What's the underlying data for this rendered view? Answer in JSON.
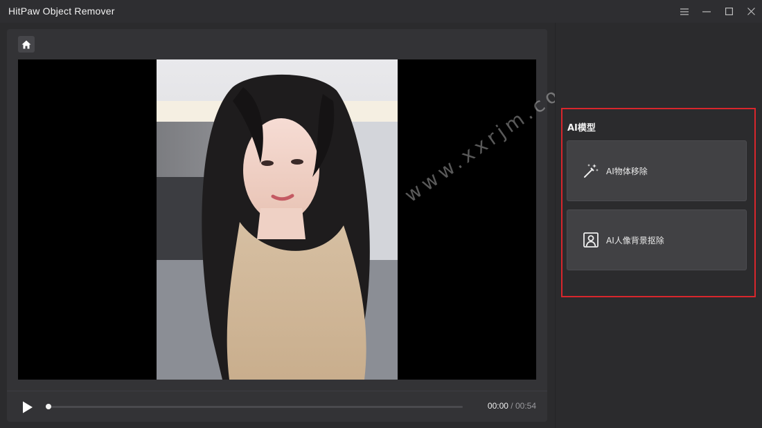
{
  "window": {
    "title": "HitPaw Object Remover",
    "controls": [
      "menu-icon",
      "minimize-icon",
      "maximize-icon",
      "close-icon"
    ]
  },
  "toolbar": {
    "home_icon": "home-icon"
  },
  "preview": {
    "watermark": "www.xxrjm.com"
  },
  "player": {
    "play_icon": "play-icon",
    "progress": 0,
    "current_time": "00:00",
    "separator": "/",
    "duration": "00:54"
  },
  "ai_models": {
    "title": "AI模型",
    "items": [
      {
        "label": "AI物体移除",
        "icon": "magic-wand-icon"
      },
      {
        "label": "AI人像背景抠除",
        "icon": "portrait-icon"
      }
    ]
  },
  "colors": {
    "highlight_border": "#d9262c",
    "background": "#2b2b2d",
    "panel": "#333336",
    "card": "#414144"
  }
}
